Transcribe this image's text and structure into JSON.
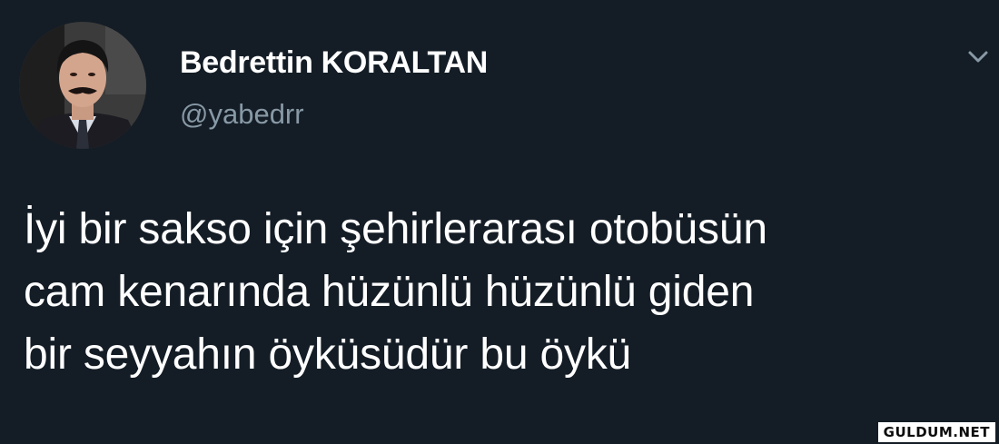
{
  "user": {
    "display_name": "Bedrettin KORALTAN",
    "handle": "@yabedrr"
  },
  "tweet": {
    "lines": [
      "İyi bir sakso için şehirlerarası otobüsün",
      "cam kenarında hüzünlü hüzünlü giden",
      "bir seyyahın öyküsüdür bu öykü"
    ]
  },
  "watermark": "GULDUM.NET",
  "icons": {
    "avatar": "profile-photo",
    "menu": "chevron-down-icon"
  },
  "colors": {
    "background": "#141d26",
    "text": "#ffffff",
    "secondary_text": "#8899a6"
  }
}
